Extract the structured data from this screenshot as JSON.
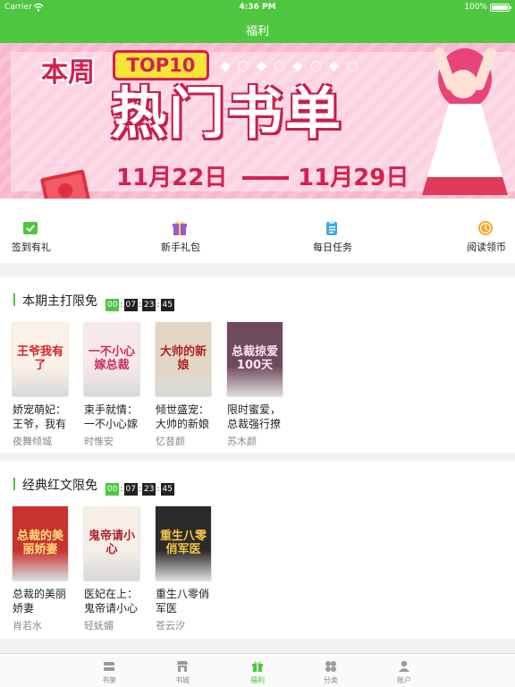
{
  "status_bar": {
    "carrier": "Carrier",
    "time": "4:36 PM",
    "battery": "100%",
    "battery_level": 1.0
  },
  "nav": {
    "title": "福利"
  },
  "banner": {
    "week": "本周",
    "badge": "TOP10",
    "title": "热门书单",
    "date_start": "11月22日",
    "date_end": "11月29日",
    "slide_count": 4,
    "active_slide": 1
  },
  "quick_actions": [
    {
      "label": "签到有礼",
      "icon": "checkin-icon",
      "color": "#4fc63f"
    },
    {
      "label": "新手礼包",
      "icon": "gift-icon",
      "color": "#9b59d0"
    },
    {
      "label": "每日任务",
      "icon": "task-clipboard-icon",
      "color": "#3fa9e8"
    },
    {
      "label": "阅读领币",
      "icon": "coin-icon",
      "color": "#f5a623"
    }
  ],
  "sections": [
    {
      "title": "本期主打限免",
      "timer": [
        "00",
        "07",
        "23",
        "45"
      ],
      "books": [
        {
          "name": "娇宠萌妃：王爷，我有",
          "author": "夜舞倾城",
          "cover_text": "王爷我有了",
          "cover_bg": "#fbf1e6",
          "cover_fg": "#d6262f"
        },
        {
          "name": "束手就情：一不小心嫁",
          "author": "时惟安",
          "cover_text": "一不小心嫁总裁",
          "cover_bg": "#f7e8ea",
          "cover_fg": "#c9305a"
        },
        {
          "name": "倾世盛宠：大帅的新娘",
          "author": "忆昔颜",
          "cover_text": "大帅的新娘",
          "cover_bg": "#e4d6c6",
          "cover_fg": "#b0242a"
        },
        {
          "name": "限时蜜爱，总裁强行撩",
          "author": "苏木颜",
          "cover_text": "总裁掠爱100天",
          "cover_bg": "#6f4a5c",
          "cover_fg": "#ffe3ec"
        }
      ]
    },
    {
      "title": "经典红文限免",
      "timer": [
        "00",
        "07",
        "23",
        "45"
      ],
      "books": [
        {
          "name": "总裁的美丽娇妻",
          "author": "肖若水",
          "cover_text": "总裁的美丽娇妻",
          "cover_bg": "#c9312e",
          "cover_fg": "#ffe07a"
        },
        {
          "name": "医妃在上：鬼帝请小心",
          "author": "轻妩媚",
          "cover_text": "鬼帝请小心",
          "cover_bg": "#f4eee6",
          "cover_fg": "#b3202c"
        },
        {
          "name": "重生八零俏军医",
          "author": "苍云汐",
          "cover_text": "重生八零俏军医",
          "cover_bg": "#2c2a28",
          "cover_fg": "#f2c64a"
        }
      ]
    }
  ],
  "tabs": [
    {
      "label": "书架",
      "icon": "bookshelf-icon",
      "active": false
    },
    {
      "label": "书城",
      "icon": "store-icon",
      "active": false
    },
    {
      "label": "福利",
      "icon": "gift-icon",
      "active": true
    },
    {
      "label": "分类",
      "icon": "category-icon",
      "active": false
    },
    {
      "label": "账户",
      "icon": "account-icon",
      "active": false
    }
  ],
  "colors": {
    "primary": "#4fc63f",
    "banner_pink": "#f9b6cf",
    "accent_red": "#d4204f",
    "text_gray": "#888888"
  }
}
